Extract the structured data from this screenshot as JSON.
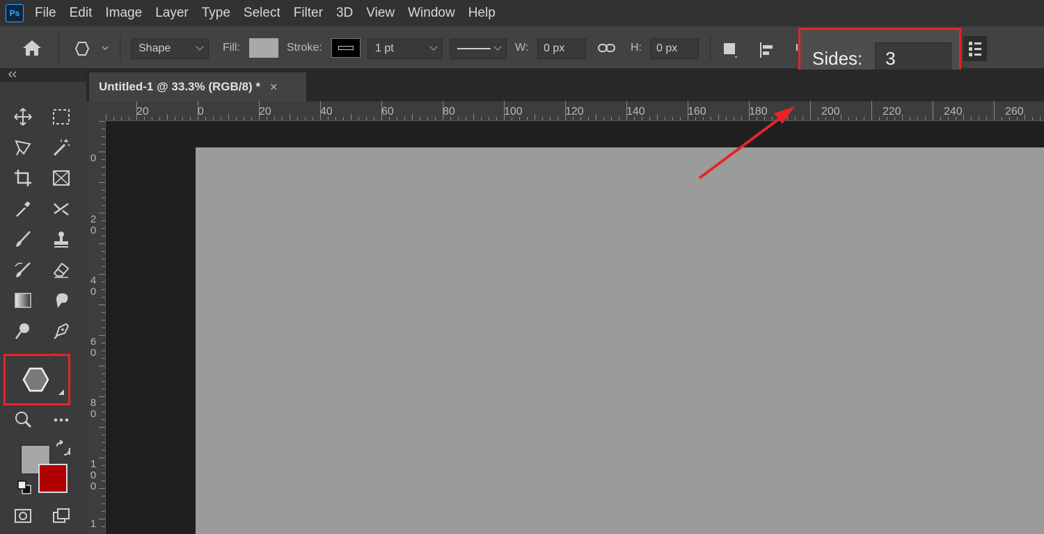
{
  "app": {
    "logo": "Ps"
  },
  "menu": [
    "File",
    "Edit",
    "Image",
    "Layer",
    "Type",
    "Select",
    "Filter",
    "3D",
    "View",
    "Window",
    "Help"
  ],
  "options_bar": {
    "mode": "Shape",
    "fill_label": "Fill:",
    "stroke_label": "Stroke:",
    "stroke_width": "1 pt",
    "w_label": "W:",
    "w_value": "0 px",
    "h_label": "H:",
    "h_value": "0 px",
    "fill_color": "#a9a9a9",
    "stroke_color": "#000000"
  },
  "sides_popup": {
    "label": "Sides:",
    "value": "3"
  },
  "document_tab": {
    "title": "Untitled-1 @ 33.3% (RGB/8) *",
    "close": "×"
  },
  "ruler_h": [
    "20",
    "0",
    "20",
    "40",
    "60",
    "80",
    "100",
    "120",
    "140",
    "160",
    "180",
    "200",
    "220",
    "240",
    "260"
  ],
  "ruler_v": [
    {
      "label": "0"
    },
    {
      "label": "2\n0"
    },
    {
      "label": "4\n0"
    },
    {
      "label": "6\n0"
    },
    {
      "label": "8\n0"
    },
    {
      "label": "1\n0\n0"
    },
    {
      "label": "1"
    }
  ],
  "colors": {
    "foreground": "#a6a6a6",
    "background": "#b00000",
    "highlight": "#e8232a"
  },
  "toolbar_icons": [
    "move-icon",
    "rectangular-marquee-icon",
    "lasso-icon",
    "magic-wand-icon",
    "crop-icon",
    "frame-icon",
    "eyedropper-icon",
    "healing-icon",
    "brush-icon",
    "stamp-icon",
    "history-brush-icon",
    "eraser-icon",
    "gradient-icon",
    "smudge-icon",
    "dodge-icon",
    "pen-icon",
    "polygon-shape-icon",
    "zoom-icon",
    "more-tools-icon"
  ]
}
